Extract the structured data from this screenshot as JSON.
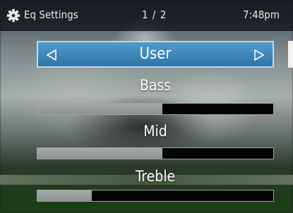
{
  "header": {
    "title": "Eq Settings",
    "page_indicator": "1 / 2",
    "time": "7:48pm",
    "icon": "gear-icon"
  },
  "preset": {
    "label": "User",
    "prev_icon": "triangle-left-icon",
    "next_icon": "triangle-right-icon",
    "colors": {
      "fill": "#3d87b8",
      "border": "#bcdaf0"
    }
  },
  "bands": [
    {
      "label": "Bass",
      "level": 0.53
    },
    {
      "label": "Mid",
      "level": 0.53
    },
    {
      "label": "Treble",
      "level": 0.23
    }
  ]
}
